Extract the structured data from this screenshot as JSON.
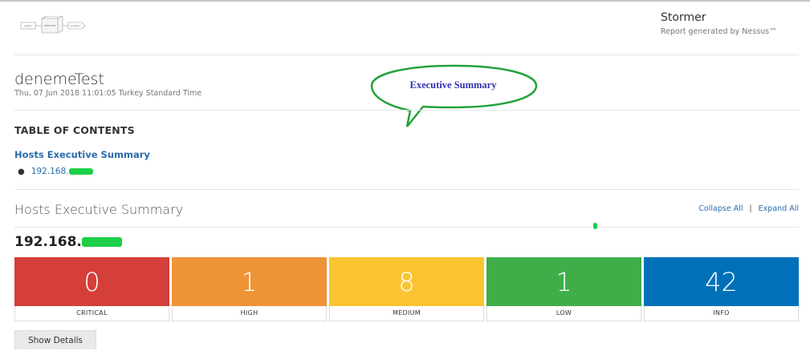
{
  "header": {
    "brand_title": "Stormer",
    "brand_subtitle": "Report generated by Nessus™",
    "logo_labels": [
      "INPUT",
      "SPOOLER",
      "OUTPUT"
    ]
  },
  "scan": {
    "title": "denemeTest",
    "date": "Thu, 07 Jun 2018 11:01:05 Turkey Standard Time"
  },
  "callout": {
    "text": "Executive Summary",
    "color": "#24a33a"
  },
  "toc": {
    "heading": "TABLE OF CONTENTS",
    "link": "Hosts Executive Summary",
    "items": [
      "192.168."
    ]
  },
  "section": {
    "title": "Hosts Executive Summary",
    "collapse_label": "Collapse All",
    "separator": "|",
    "expand_label": "Expand All"
  },
  "host": {
    "ip_prefix": "192.168.",
    "severities": [
      {
        "label": "CRITICAL",
        "count": "0",
        "color": "#d43f3a"
      },
      {
        "label": "HIGH",
        "count": "1",
        "color": "#ee9336"
      },
      {
        "label": "MEDIUM",
        "count": "8",
        "color": "#fdc431"
      },
      {
        "label": "LOW",
        "count": "1",
        "color": "#3fae49"
      },
      {
        "label": "INFO",
        "count": "42",
        "color": "#0071b9"
      }
    ],
    "show_details_label": "Show Details"
  },
  "redaction_color": "#1dcf48"
}
